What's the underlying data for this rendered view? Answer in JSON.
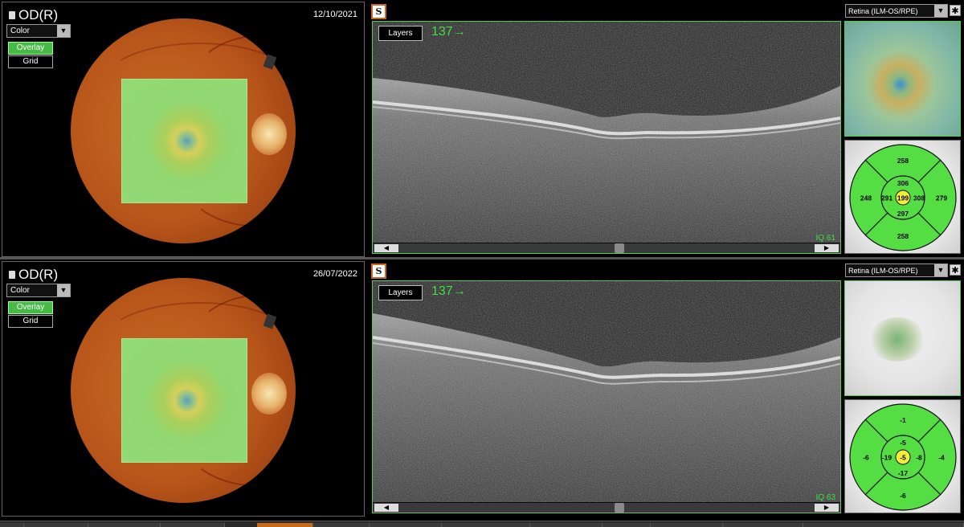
{
  "exams": [
    {
      "eye_label": "OD(R)",
      "date": "12/10/2021",
      "mode_select": "Color",
      "overlay_label": "Overlay",
      "grid_label": "Grid",
      "layers_label": "Layers",
      "slice_number": "137→",
      "iq": "IQ 61",
      "map_type": "Retina (ILM-OS/RPE)",
      "thumb_caption": "",
      "etdrs_caption": "",
      "etdrs": {
        "center": "199",
        "inner_top": "306",
        "inner_left": "291",
        "inner_right": "308",
        "inner_bottom": "297",
        "outer_top": "258",
        "outer_left": "248",
        "outer_right": "279",
        "outer_bottom": "258"
      }
    },
    {
      "eye_label": "OD(R)",
      "date": "26/07/2022",
      "mode_select": "Color",
      "overlay_label": "Overlay",
      "grid_label": "Grid",
      "layers_label": "Layers",
      "slice_number": "137→",
      "iq": "IQ 63",
      "map_type": "Retina (ILM-OS/RPE)",
      "thumb_caption": "",
      "etdrs_caption": "",
      "etdrs": {
        "center": "-5",
        "inner_top": "-5",
        "inner_left": "-19",
        "inner_right": "-8",
        "inner_bottom": "-17",
        "outer_top": "-1",
        "outer_left": "-6",
        "outer_right": "-4",
        "outer_bottom": "-6"
      }
    }
  ],
  "colors": {
    "accent_green": "#3fe03f",
    "etdrs_green": "#55dd44",
    "etdrs_center": "#f4ee3a",
    "active_tab": "#c96a1a"
  },
  "icons": {
    "scan_icon": "oct-scan-icon",
    "settings_icon": "asterisk-settings-icon",
    "lock_icon": "lock-icon"
  }
}
